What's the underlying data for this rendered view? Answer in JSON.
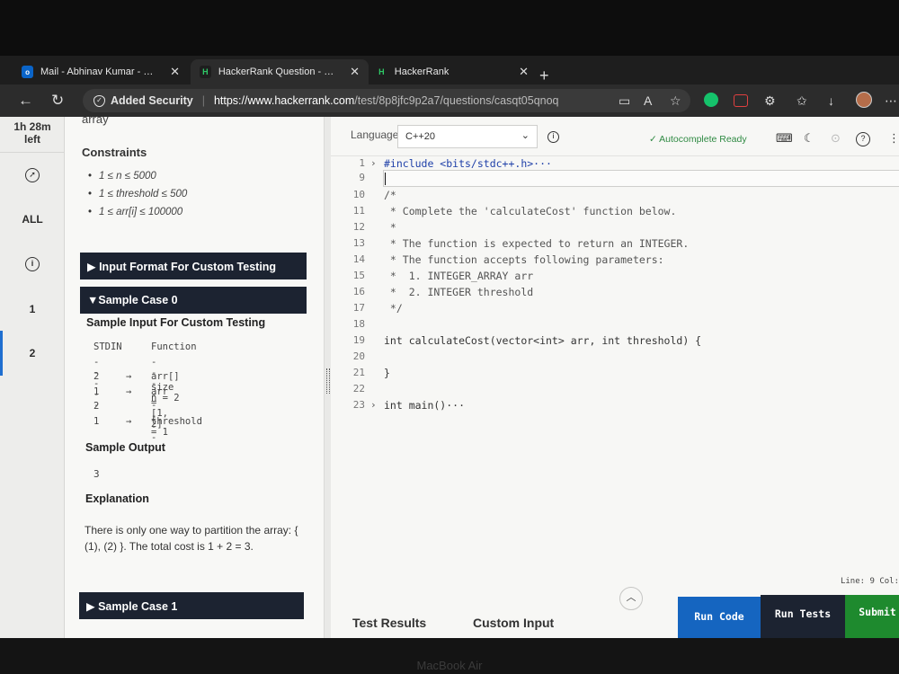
{
  "browser": {
    "tabs": [
      {
        "label": "Mail - Abhinav Kumar - Outloo",
        "close": "✕"
      },
      {
        "label": "HackerRank Question - Calcula",
        "close": "✕"
      },
      {
        "label": "HackerRank",
        "close": "✕"
      }
    ],
    "new_tab": "+",
    "security_label": "Added Security",
    "url_host": "https://www.hackerrank.com",
    "url_path": "/test/8p8jfc9p2a7/questions/casqt05qnoq"
  },
  "rail": {
    "timer_line1": "1h 28m",
    "timer_line2": "left",
    "all_label": "ALL",
    "q1": "1",
    "q2": "2"
  },
  "problem": {
    "array_fragment": "array",
    "constraints_heading": "Constraints",
    "constraints": [
      "1 ≤ n ≤ 5000",
      "1 ≤ threshold ≤ 500",
      "1 ≤ arr[i] ≤ 100000"
    ],
    "input_format_title": "▶ Input Format For Custom Testing",
    "sample0_title": "▼Sample Case 0",
    "sample_input_heading": "Sample Input For Custom Testing",
    "stdin_rows": [
      [
        "STDIN",
        "",
        "Function"
      ],
      [
        "-----",
        "",
        "--------"
      ],
      [
        "2",
        "→",
        "arr[] size n = 2"
      ],
      [
        "1",
        "→",
        "arr = [1, 2]"
      ],
      [
        "2",
        "",
        ""
      ],
      [
        "1",
        "→",
        "threshold = 1"
      ]
    ],
    "sample_output_heading": "Sample Output",
    "sample_output": "3",
    "explanation_heading": "Explanation",
    "explanation": "There is only one way to partition the array: { (1), (2) }. The total cost is 1 + 2 = 3.",
    "sample1_title": "▶ Sample Case 1"
  },
  "editor": {
    "language_label": "Language",
    "language_value": "C++20",
    "autocomplete": "Autocomplete Ready",
    "lines": [
      {
        "n": "1",
        "fold": "›",
        "text": "#include <bits/stdc++.h>···"
      },
      {
        "n": "9",
        "fold": "",
        "text": ""
      },
      {
        "n": "10",
        "fold": "",
        "text": "/*"
      },
      {
        "n": "11",
        "fold": "",
        "text": " * Complete the 'calculateCost' function below."
      },
      {
        "n": "12",
        "fold": "",
        "text": " *"
      },
      {
        "n": "13",
        "fold": "",
        "text": " * The function is expected to return an INTEGER."
      },
      {
        "n": "14",
        "fold": "",
        "text": " * The function accepts following parameters:"
      },
      {
        "n": "15",
        "fold": "",
        "text": " *  1. INTEGER_ARRAY arr"
      },
      {
        "n": "16",
        "fold": "",
        "text": " *  2. INTEGER threshold"
      },
      {
        "n": "17",
        "fold": "",
        "text": " */"
      },
      {
        "n": "18",
        "fold": "",
        "text": ""
      },
      {
        "n": "19",
        "fold": "",
        "text": "int calculateCost(vector<int> arr, int threshold) {"
      },
      {
        "n": "20",
        "fold": "",
        "text": ""
      },
      {
        "n": "21",
        "fold": "",
        "text": "}"
      },
      {
        "n": "22",
        "fold": "",
        "text": ""
      },
      {
        "n": "23",
        "fold": "›",
        "text": "int main()···"
      }
    ],
    "line_col": "Line: 9 Col:",
    "test_results": "Test Results",
    "custom_input": "Custom Input",
    "run_code": "Run Code",
    "run_tests": "Run Tests",
    "submit": "Submit"
  },
  "colors": {
    "run_code_bg": "#1565c0",
    "run_tests_bg": "#1c2331",
    "submit_bg": "#1e8a2e",
    "accordion_bg": "#1c2331",
    "autocomplete_green": "#2f8a43"
  },
  "device_label": "MacBook Air"
}
